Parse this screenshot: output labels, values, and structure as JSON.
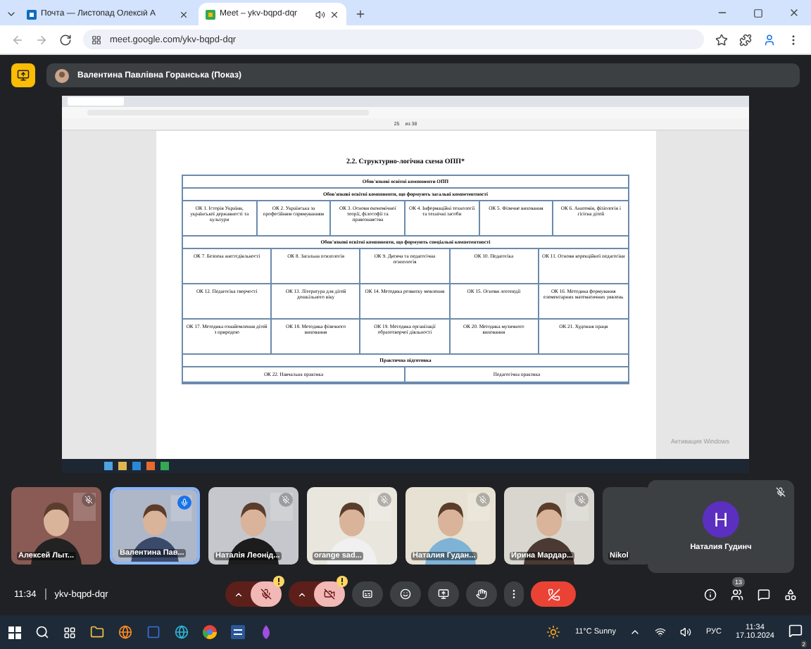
{
  "browser": {
    "tabs": [
      {
        "title": "Почта — Листопад Олексій А",
        "selected": false,
        "audio": false
      },
      {
        "title": "Meet – ykv-bqpd-dqr",
        "selected": true,
        "audio": true
      }
    ],
    "url": "meet.google.com/ykv-bqpd-dqr"
  },
  "presenter": {
    "label": "Валентина Павлівна Горанська (Показ)"
  },
  "shared_screen": {
    "page": "25",
    "page_total": "из 38",
    "document": {
      "title": "2.2. Структурно-логічна схема ОПП*",
      "main_heading": "Обов'язкові освітні компоненти ОПП",
      "sections": [
        {
          "heading": "Обов'язкові освітні компоненти, що формують загальні компетентності",
          "rows": [
            [
              "ОК 1. Історія України, української державності та культури",
              "ОК 2. Українська за професійним спрямуванням",
              "ОК 3. Основи економічної теорії, філософії та правознавства",
              "ОК 4. Інформаційні технології та технічні засоби",
              "ОК 5. Фізичне виховання",
              "ОК 6. Анатомія, фізіологія і гігієна дітей"
            ]
          ]
        },
        {
          "heading": "Обов'язкові освітні компоненти, що формують спеціальні компетентності",
          "rows": [
            [
              "ОК 7. Безпека життєдіяльності",
              "ОК 8. Загальна психологія",
              "ОК 9. Дитяча та педагогічна психологія",
              "ОК 10. Педагогіка",
              "ОК 11. Основи корекційної педагогіки"
            ],
            [
              "ОК 12. Педагогіка творчості",
              "ОК 13. Література для дітей дошкільного віку",
              "ОК 14. Методика розвитку мовлення",
              "ОК 15. Основи логопедії",
              "ОК 16. Методика формування елементарних математичних уявлень"
            ],
            [
              "ОК 17. Методика ознайомлення дітей з природою",
              "ОК 18. Методика фізичного виховання",
              "ОК 19. Методика організації образотворчої діяльності",
              "ОК 20. Методика музичного виховання",
              "ОК 21. Художня праця"
            ]
          ]
        },
        {
          "heading": "Практична підготовка",
          "rows": [
            [
              "ОК 22. Навчальна практика",
              "Педагогічна практика"
            ]
          ]
        }
      ]
    },
    "activation_notice": "Активация Windows"
  },
  "participants": [
    {
      "name": "Алексей Лыт...",
      "selected": false,
      "speaking": false,
      "muted": true
    },
    {
      "name": "Валентина Пав...",
      "selected": true,
      "speaking": true,
      "muted": false
    },
    {
      "name": "Наталія Леонід...",
      "selected": false,
      "speaking": false,
      "muted": true
    },
    {
      "name": "orange sad...",
      "selected": false,
      "speaking": false,
      "muted": true
    },
    {
      "name": "Наталия Гудан...",
      "selected": false,
      "speaking": false,
      "muted": true
    },
    {
      "name": "Ирина Мардар...",
      "selected": false,
      "speaking": false,
      "muted": true
    },
    {
      "name": "Nikol",
      "selected": false
    }
  ],
  "self_view": {
    "name": "Наталия Гудинч",
    "initial": "H",
    "color": "#5b2fc0",
    "muted": true
  },
  "call_bar": {
    "time": "11:34",
    "meeting_code": "ykv-bqpd-dqr",
    "mic_on": false,
    "camera_on": false,
    "people_count": "13"
  },
  "taskbar": {
    "weather": "11°C  Sunny",
    "language": "РУС",
    "time": "11:34",
    "date": "17.10.2024",
    "notifications": "2"
  }
}
